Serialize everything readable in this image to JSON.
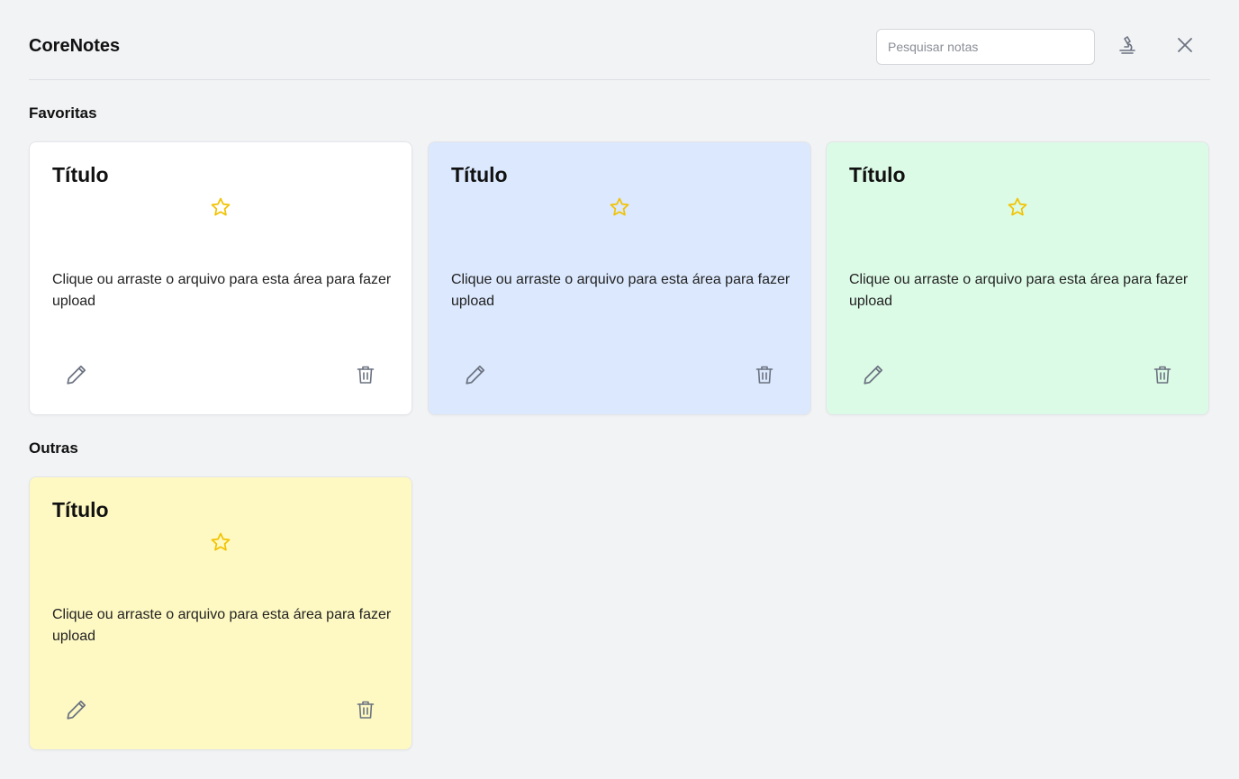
{
  "app": {
    "title": "CoreNotes"
  },
  "search": {
    "placeholder": "Pesquisar notas",
    "value": ""
  },
  "header_buttons": [
    {
      "icon": "microscope-icon"
    },
    {
      "icon": "close-icon"
    }
  ],
  "sections": {
    "favorites": {
      "title": "Favoritas",
      "notes": [
        {
          "title": "Título",
          "body": "Clique ou arraste o arquivo para esta área para fazer upload",
          "color": "#ffffff",
          "favorited": false
        },
        {
          "title": "Título",
          "body": "Clique ou arraste o arquivo para esta área para fazer upload",
          "color": "#dbe8fd",
          "favorited": false
        },
        {
          "title": "Título",
          "body": "Clique ou arraste o arquivo para esta área para fazer upload",
          "color": "#dcfbe6",
          "favorited": false
        }
      ]
    },
    "others": {
      "title": "Outras",
      "notes": [
        {
          "title": "Título",
          "body": "Clique ou arraste o arquivo para esta área para fazer upload",
          "color": "#fef9c2",
          "favorited": false
        }
      ]
    }
  },
  "colors": {
    "background": "#f2f3f5",
    "star": "#f2c200",
    "icon": "#6b7280"
  }
}
